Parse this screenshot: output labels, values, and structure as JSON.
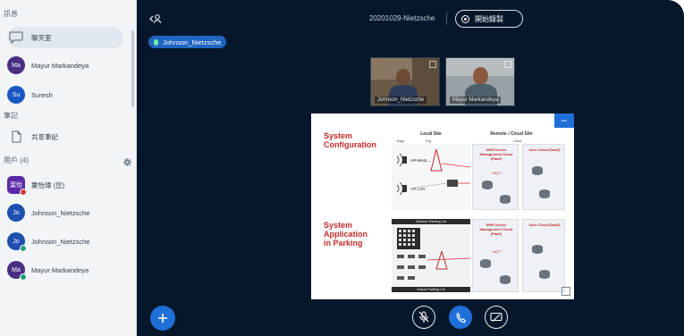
{
  "sidebar": {
    "messages_label": "訊息",
    "chat_item": "聊天室",
    "users_top": [
      {
        "initials": "Ma",
        "name": "Mayur Markandeya",
        "color": "#4a2f83"
      },
      {
        "initials": "Su",
        "name": "Suresh",
        "color": "#1a56c4"
      }
    ],
    "notes_label": "筆記",
    "shared_notes_item": "共享筆記",
    "users_label": "用戶 (4)",
    "users": [
      {
        "initials": "葉怡",
        "name": "葉怡璋 (您)",
        "color": "#5b2aa8",
        "dot": "#d03a3a",
        "square": true
      },
      {
        "initials": "Jo",
        "name": "Johnson_Nietzsche",
        "color": "#1e4fb0",
        "dot": "",
        "square": false
      },
      {
        "initials": "Jo",
        "name": "Johnson_Nietzsche",
        "color": "#1e4fb0",
        "dot": "#1ea07a",
        "square": false
      },
      {
        "initials": "Ma",
        "name": "Mayur Markandeya",
        "color": "#4a2f83",
        "dot": "#1ea07a",
        "square": false
      }
    ]
  },
  "main": {
    "meeting_title": "20201029-Nietzsche",
    "record_label": "開始錄製",
    "presenter_name": "Johnson_Nietzsche",
    "videos": [
      {
        "name": "Johnson_Nietzsche"
      },
      {
        "name": "Mayur Markandeya"
      }
    ]
  },
  "slide": {
    "heading_1_line1": "System",
    "heading_1_line2": "Configuration",
    "heading_2_line1": "System",
    "heading_2_line2": "Application",
    "heading_2_line3": "in Parking",
    "local_site": "Local Site",
    "remote_site": "Remote / Cloud Site",
    "edge": "Edge",
    "fog": "Fog",
    "cloud": "Cloud",
    "lp_wan": "LP WAN",
    "lp_lan": "LP LAN",
    "device_mgmt_cloud": "NHR Device Management Cloud (PaaS)",
    "user_cloud": "User Cloud (SaaS)",
    "outdoor_parking": "Outdoor Parking Lot",
    "indoor_parking": "Indoor Parking Lot",
    "mqtt": "MQTT"
  },
  "colors": {
    "accent": "#1f6fd8",
    "main_bg": "#06172b",
    "sidebar_bg": "#f2f5f8",
    "heading_red": "#c42a2a"
  },
  "icons": {
    "chat": "chat-bubble-icon",
    "notes": "document-icon",
    "settings": "gear-icon",
    "collapse": "users-icon",
    "mic_off": "mic-off-icon",
    "phone": "phone-icon",
    "screen_share": "screen-share-icon",
    "add": "plus-icon"
  }
}
